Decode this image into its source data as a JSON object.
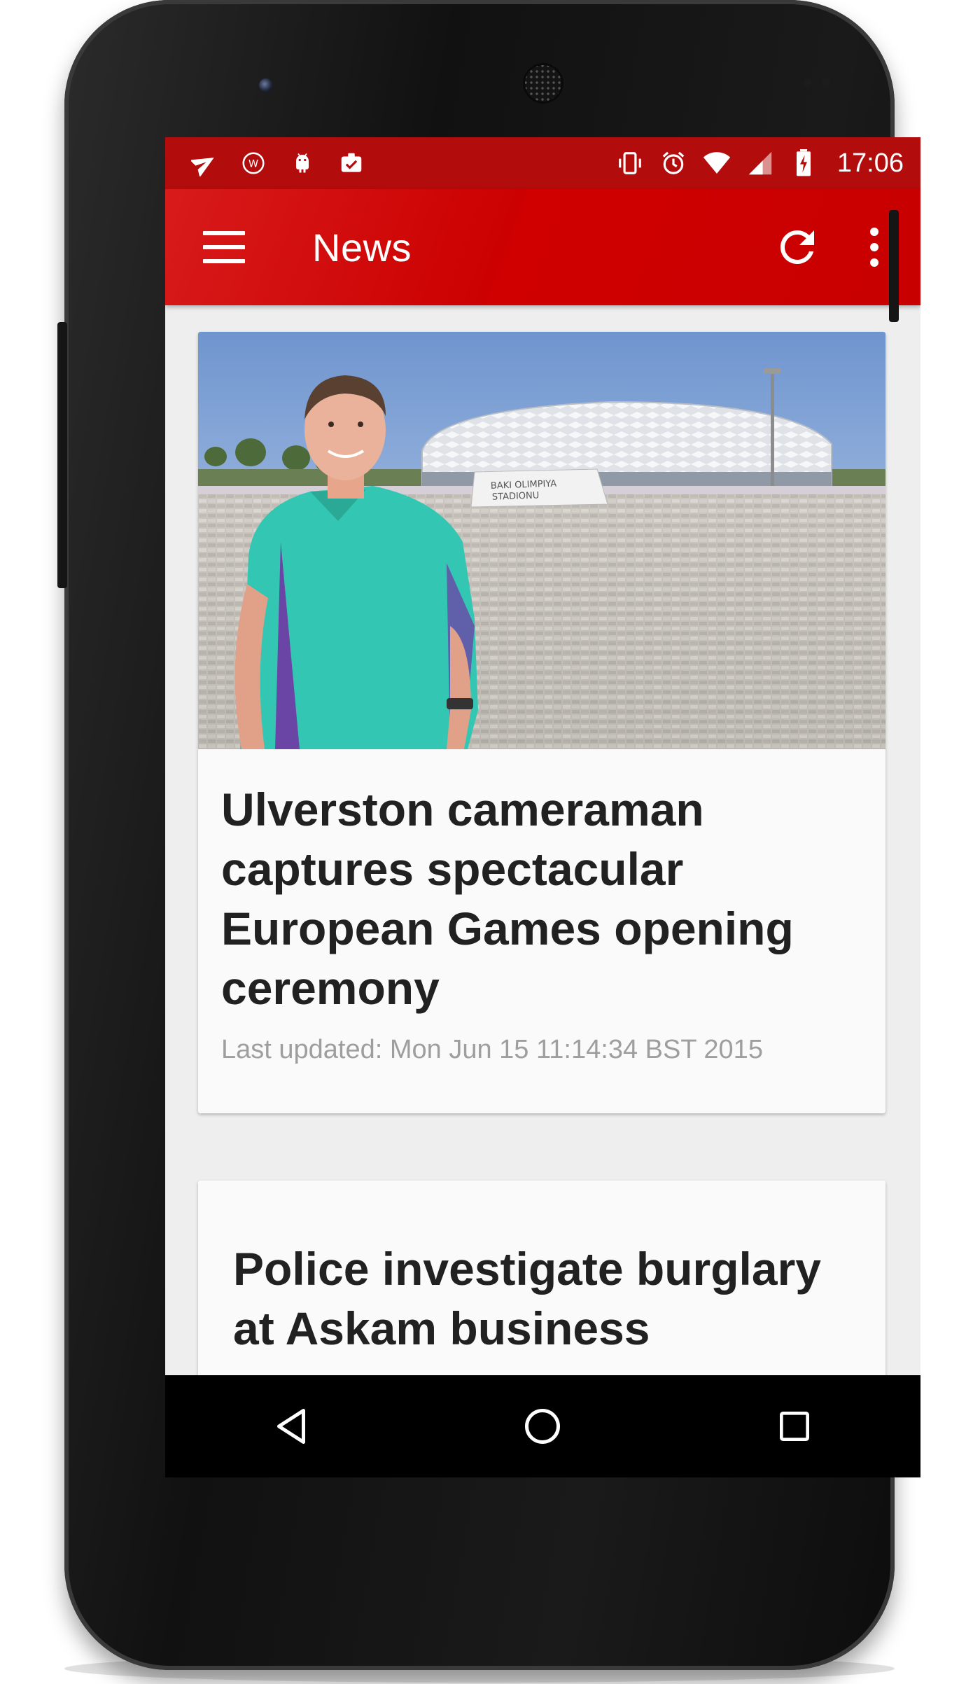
{
  "status_bar": {
    "time": "17:06",
    "left_icons": [
      "send-icon",
      "w-badge-icon",
      "android-icon",
      "clipboard-check-icon"
    ],
    "right_icons": [
      "vibrate-icon",
      "alarm-icon",
      "wifi-icon",
      "signal-icon",
      "battery-charging-icon"
    ]
  },
  "toolbar": {
    "title": "News",
    "menu_icon": "hamburger-menu-icon",
    "refresh_icon": "refresh-icon",
    "overflow_icon": "more-vertical-icon",
    "color": "#cc0000"
  },
  "articles": [
    {
      "title": "Ulverston cameraman captures spectacular European Games opening ceremony",
      "last_updated": "Last updated: Mon Jun 15 11:14:34 BST 2015",
      "image": {
        "sign_line1": "BAKI OLIMPIYA",
        "sign_line2": "STADIONU"
      }
    },
    {
      "title": "Police investigate burglary at Askam business"
    }
  ],
  "navigation_bar": {
    "icons": [
      "back-icon",
      "home-icon",
      "recents-icon"
    ]
  }
}
